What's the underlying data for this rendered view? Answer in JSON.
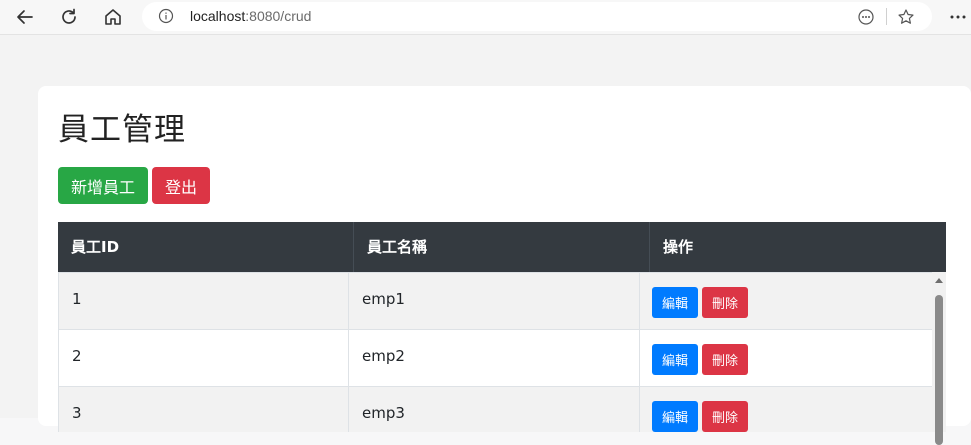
{
  "browser": {
    "url_host": "localhost",
    "url_rest": ":8080/crud",
    "icons": [
      "back-icon",
      "reload-icon",
      "home-icon",
      "info-icon",
      "reader-icon",
      "favorite-star-icon",
      "more-menu-icon"
    ]
  },
  "page": {
    "title": "員工管理",
    "add_button": "新增員工",
    "logout_button": "登出"
  },
  "table": {
    "headers": [
      "員工ID",
      "員工名稱",
      "操作"
    ],
    "rows": [
      {
        "id": "1",
        "name": "emp1",
        "edit": "編輯",
        "delete": "刪除"
      },
      {
        "id": "2",
        "name": "emp2",
        "edit": "編輯",
        "delete": "刪除"
      },
      {
        "id": "3",
        "name": "emp3",
        "edit": "編輯",
        "delete": "刪除"
      }
    ]
  },
  "colors": {
    "success": "#28a745",
    "danger": "#dc3545",
    "primary": "#007bff",
    "table_header": "#343a40"
  }
}
